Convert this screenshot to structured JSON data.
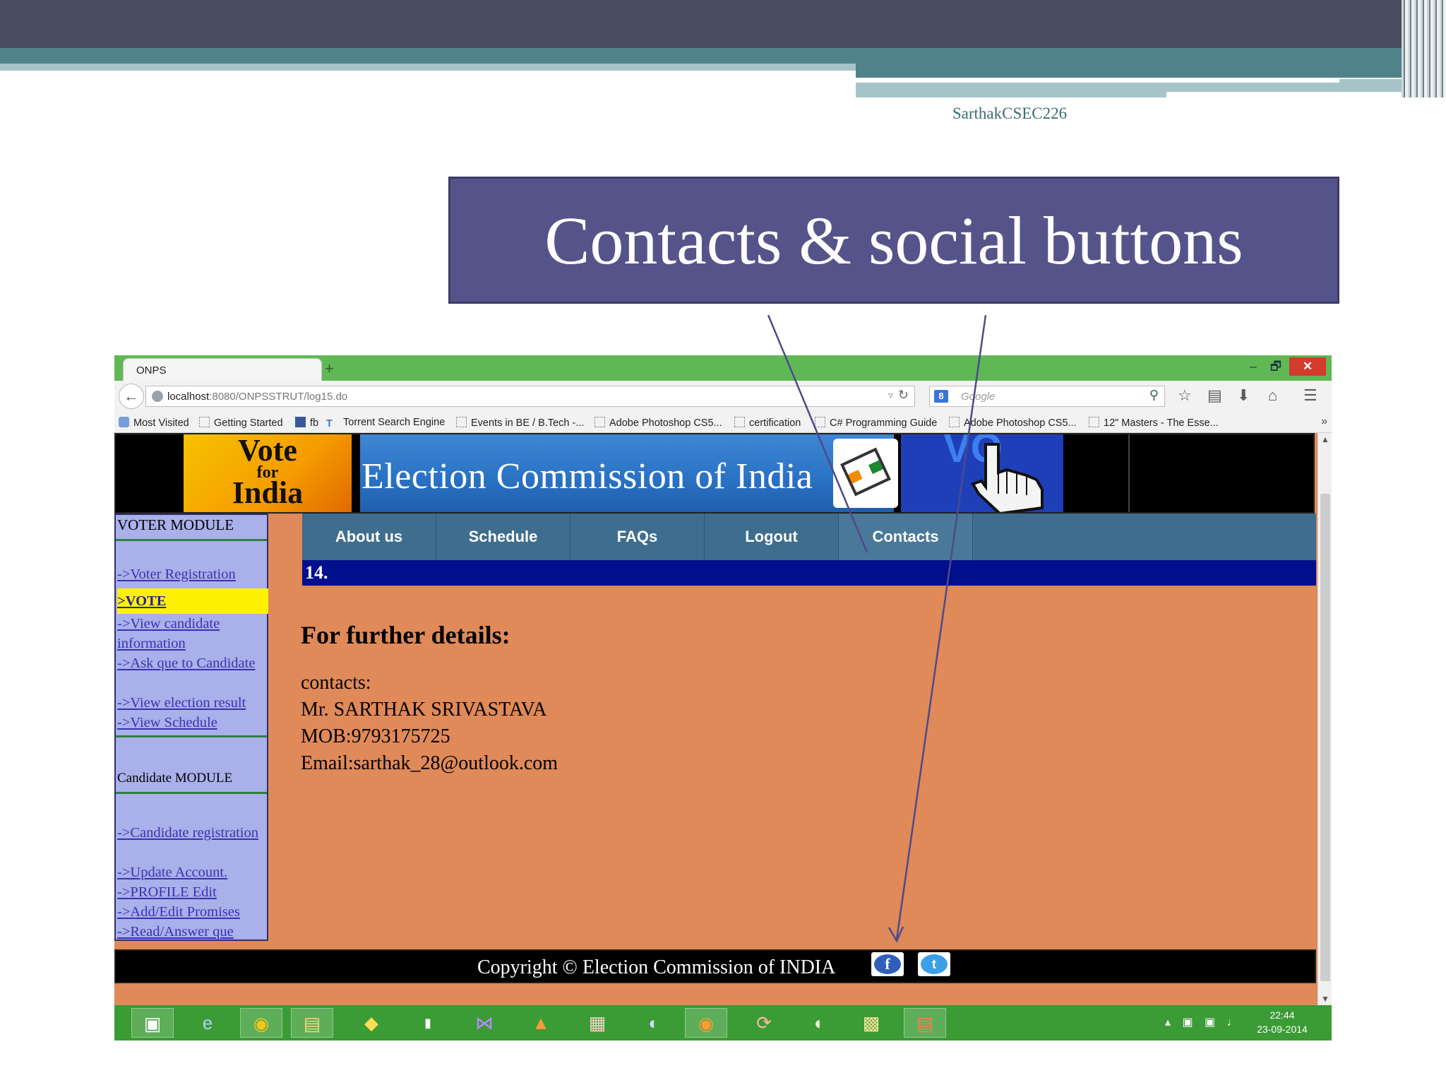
{
  "slide": {
    "author": "SarthakCSEC226",
    "title": "Contacts & social buttons"
  },
  "browser": {
    "tab_title": "ONPS",
    "new_tab": "+",
    "window_controls": {
      "minimize": "–",
      "maximize": "🗗",
      "close": "✕"
    },
    "url_host": "localhost",
    "url_path": ":8080/ONPSSTRUT/log15.do",
    "search_placeholder": "Google",
    "bookmarks": [
      "Most Visited",
      "Getting Started",
      "fb",
      "Torrent Search Engine",
      "Events in BE / B.Tech -...",
      "Adobe Photoshop CS5...",
      "certification",
      "C# Programming Guide",
      "Adobe Photoshop CS5...",
      "12\" Masters - The Esse..."
    ],
    "bookmarks_more": "»"
  },
  "site": {
    "banner": {
      "vote_line1": "Vote",
      "vote_line2": "for",
      "vote_line3": "India",
      "title": "Election Commission of India",
      "hand_text": "VO"
    },
    "sidebar": {
      "voter_module_title": "VOTER MODULE",
      "voter_links": [
        "->Voter Registration",
        ">VOTE",
        "->View candidate information",
        "->Ask que to Candidate",
        "->View election result",
        "->View Schedule"
      ],
      "candidate_module_title": "Candidate MODULE",
      "candidate_links": [
        "->Candidate registration",
        "->Update Account.",
        "->PROFILE Edit",
        "->Add/Edit Promises",
        "->Read/Answer que"
      ]
    },
    "menu": [
      "About us",
      "Schedule",
      "FAQs",
      "Logout",
      "Contacts"
    ],
    "notice": "14.",
    "details_title": "For further details:",
    "contact_lines": [
      "contacts:",
      "Mr. SARTHAK SRIVASTAVA",
      "MOB:9793175725",
      "Email:sarthak_28@outlook.com"
    ],
    "footer": {
      "copyright": "Copyright © Election Commission of INDIA",
      "facebook_glyph": "f",
      "twitter_glyph": "t"
    }
  },
  "taskbar": {
    "icons": [
      "virtualbox-icon",
      "internet-explorer-icon",
      "chrome-icon",
      "file-explorer-icon",
      "python-icon",
      "command-prompt-icon",
      "visual-studio-icon",
      "matlab-icon",
      "ms-project-icon",
      "eclipse-icon",
      "firefox-icon",
      "app-icon",
      "dreamweaver-icon",
      "excel-chart-icon",
      "powerpoint-icon"
    ],
    "time": "22:44",
    "date": "23-09-2014"
  }
}
